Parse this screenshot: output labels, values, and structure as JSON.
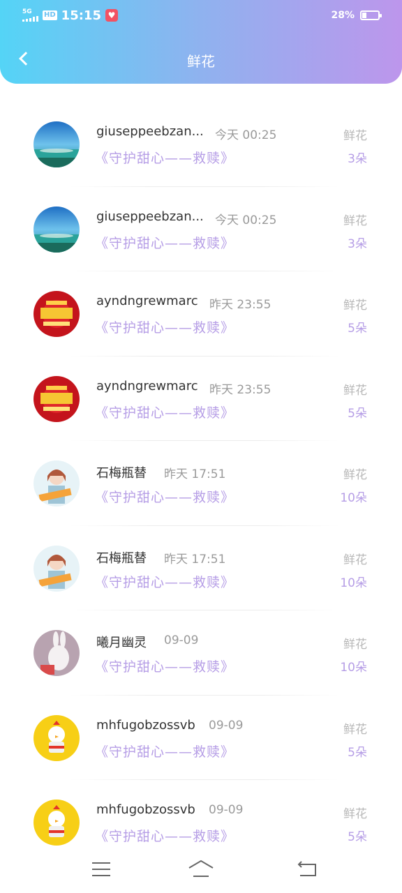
{
  "status_bar": {
    "network": "5G",
    "hd": "HD",
    "time": "15:15",
    "battery": "28%",
    "battery_level": 0.28
  },
  "header": {
    "title": "鲜花"
  },
  "colors": {
    "accent_purple": "#b69ee6",
    "gradient_start": "#54d4f6",
    "gradient_end": "#bd96ec"
  },
  "rows": [
    {
      "username": "giuseppeebzan...",
      "time": "今天 00:25",
      "gift": "《守护甜心——救赎》",
      "label": "鲜花",
      "count": "3朵",
      "avatar": "sea-avatar"
    },
    {
      "username": "giuseppeebzan...",
      "time": "今天 00:25",
      "gift": "《守护甜心——救赎》",
      "label": "鲜花",
      "count": "3朵",
      "avatar": "sea-avatar"
    },
    {
      "username": "ayndngrewmarc",
      "time": "昨天 23:55",
      "gift": "《守护甜心——救赎》",
      "label": "鲜花",
      "count": "5朵",
      "avatar": "red-promo-avatar"
    },
    {
      "username": "ayndngrewmarc",
      "time": "昨天 23:55",
      "gift": "《守护甜心——救赎》",
      "label": "鲜花",
      "count": "5朵",
      "avatar": "red-promo-avatar"
    },
    {
      "username": "石梅瓶替",
      "time": "昨天 17:51",
      "gift": "《守护甜心——救赎》",
      "label": "鲜花",
      "count": "10朵",
      "avatar": "anime-girl-avatar"
    },
    {
      "username": "石梅瓶替",
      "time": "昨天 17:51",
      "gift": "《守护甜心——救赎》",
      "label": "鲜花",
      "count": "10朵",
      "avatar": "anime-girl-avatar"
    },
    {
      "username": "曦月幽灵",
      "time": "09-09",
      "gift": "《守护甜心——救赎》",
      "label": "鲜花",
      "count": "10朵",
      "avatar": "rabbit-avatar"
    },
    {
      "username": "mhfugobzossvb",
      "time": "09-09",
      "gift": "《守护甜心——救赎》",
      "label": "鲜花",
      "count": "5朵",
      "avatar": "chicken-avatar"
    },
    {
      "username": "mhfugobzossvb",
      "time": "09-09",
      "gift": "《守护甜心——救赎》",
      "label": "鲜花",
      "count": "5朵",
      "avatar": "chicken-avatar"
    }
  ],
  "system_nav": {
    "menu_icon": "menu-icon",
    "home_icon": "home-icon",
    "back_icon": "return-icon"
  }
}
